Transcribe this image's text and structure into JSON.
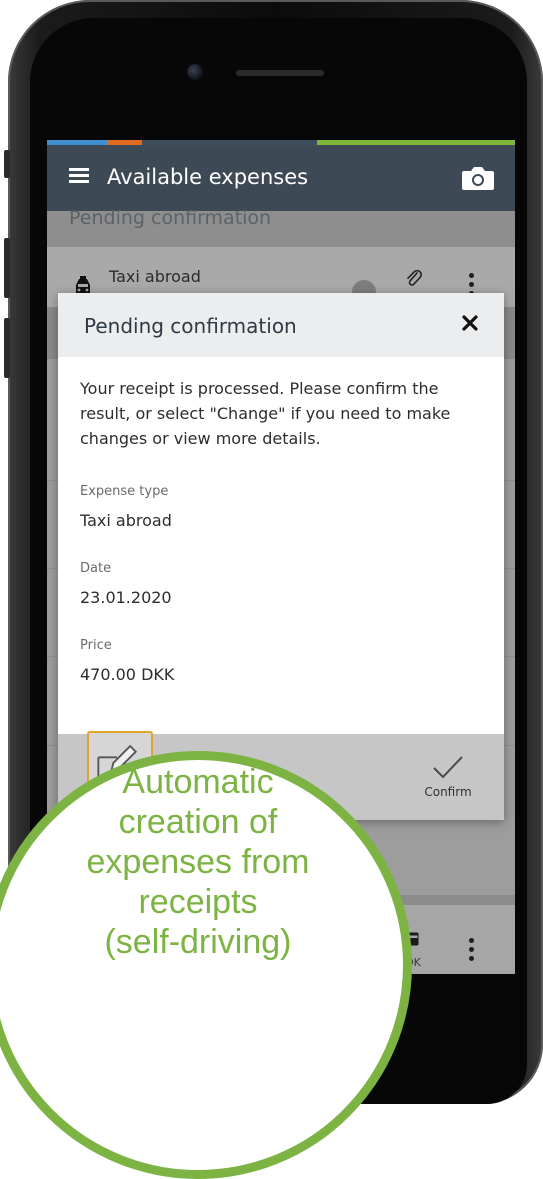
{
  "header": {
    "title": "Available expenses"
  },
  "list": {
    "section_title": "Pending confirmation",
    "expense_item": {
      "title": "Taxi abroad"
    },
    "bottom_item": {
      "status_partial": "OK"
    }
  },
  "modal": {
    "title": "Pending confirmation",
    "message": "Your receipt is processed. Please confirm the result, or select \"Change\" if you need to make changes or view more details.",
    "fields": [
      {
        "label": "Expense type",
        "value": "Taxi abroad"
      },
      {
        "label": "Date",
        "value": "23.01.2020"
      },
      {
        "label": "Price",
        "value": "470.00 DKK"
      }
    ],
    "confirm_label": "Confirm"
  },
  "callout": {
    "lines": [
      "Automatic",
      "creation of",
      "expenses from",
      "receipts",
      "(self-driving)"
    ],
    "color": "#7cb342"
  },
  "colors": {
    "header_bg": "#3d4a55",
    "edit_highlight": "#e0a42a"
  },
  "icons": {
    "menu": "hamburger-menu-icon",
    "camera": "camera-icon",
    "taxi": "taxi-icon",
    "attachment": "paperclip-icon",
    "more": "more-vertical-icon",
    "close": "close-icon",
    "edit": "edit-icon",
    "confirm": "checkmark-icon",
    "card": "credit-card-icon"
  }
}
